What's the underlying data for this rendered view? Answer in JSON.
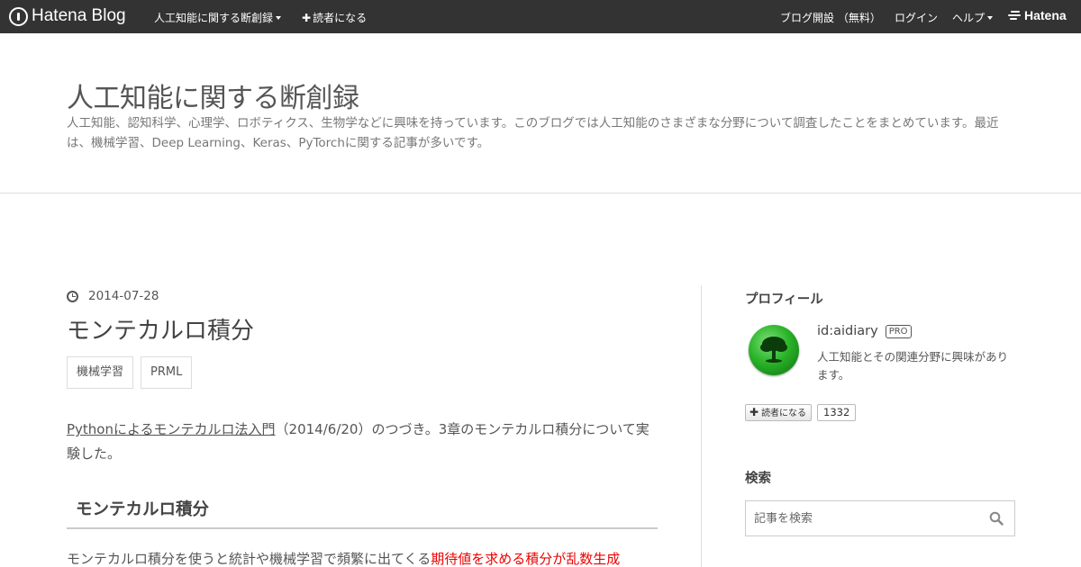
{
  "topbar": {
    "brand": "Hatena Blog",
    "blog_menu": "人工知能に関する断創録",
    "subscribe": "読者になる",
    "open_blog": "ブログ開設 （無料）",
    "login": "ログイン",
    "help": "ヘルプ",
    "hatena": "Hatena"
  },
  "header": {
    "title": "人工知能に関する断創録",
    "description": "人工知能、認知科学、心理学、ロボティクス、生物学などに興味を持っています。このブログでは人工知能のさまざまな分野について調査したことをまとめています。最近は、機械学習、Deep Learning、Keras、PyTorchに関する記事が多いです。"
  },
  "post": {
    "date": "2014-07-28",
    "title": "モンテカルロ積分",
    "tags": [
      "機械学習",
      "PRML"
    ],
    "intro_link": "Pythonによるモンテカルロ法入門",
    "intro_rest": "（2014/6/20）のつづき。3章のモンテカルロ積分について実験した。",
    "section_heading": "モンテカルロ積分",
    "para_plain": "モンテカルロ積分を使うと統計や機械学習で頻繁に出てくる",
    "para_highlight": "期待値を求める積分が乱数生成"
  },
  "sidebar": {
    "profile_heading": "プロフィール",
    "profile_id": "id:aidiary",
    "pro_badge": "PRO",
    "profile_desc": "人工知能とその関連分野に興味があります。",
    "subscribe_label": "読者になる",
    "subscriber_count": "1332",
    "search_heading": "検索",
    "search_placeholder": "記事を検索"
  },
  "colors": {
    "topbar_bg": "#333333",
    "highlight": "#ee0000",
    "text": "#555555"
  }
}
